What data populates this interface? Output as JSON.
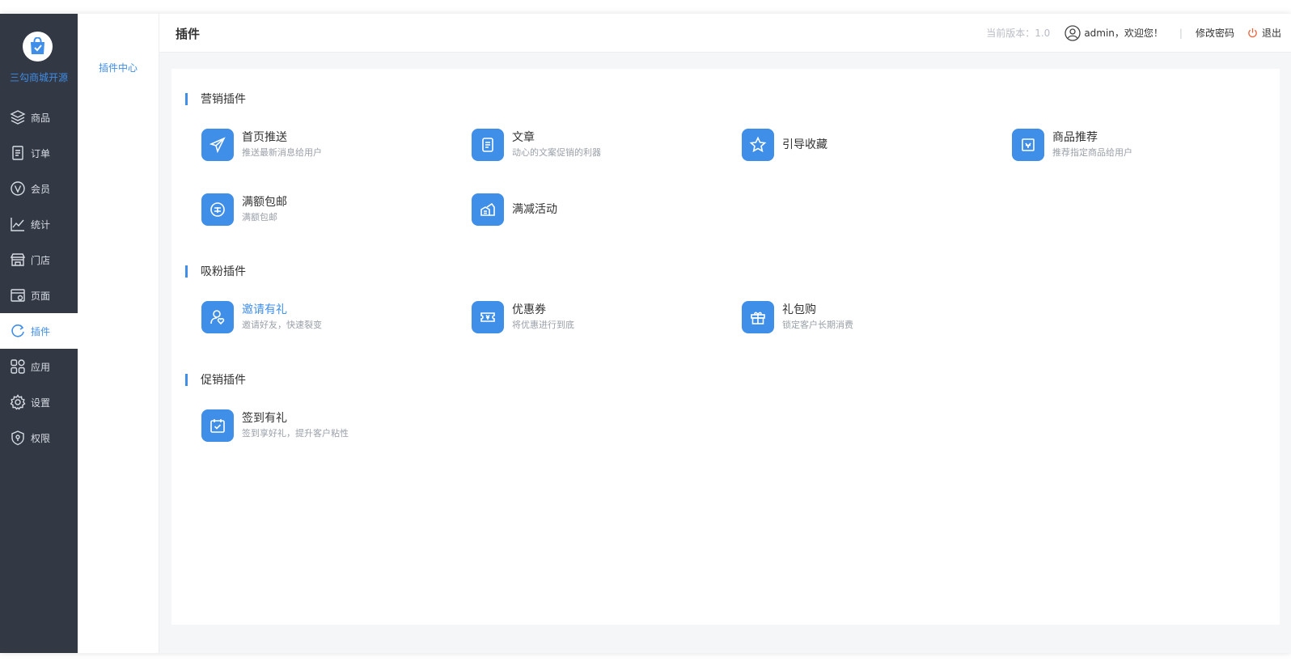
{
  "brand": {
    "name": "三勾商城开源"
  },
  "nav": [
    {
      "label": "商品",
      "icon": "layers-icon"
    },
    {
      "label": "订单",
      "icon": "order-icon"
    },
    {
      "label": "会员",
      "icon": "vip-icon"
    },
    {
      "label": "统计",
      "icon": "chart-icon"
    },
    {
      "label": "门店",
      "icon": "store-icon"
    },
    {
      "label": "页面",
      "icon": "page-icon"
    },
    {
      "label": "插件",
      "icon": "plugin-icon",
      "active": true
    },
    {
      "label": "应用",
      "icon": "apps-icon"
    },
    {
      "label": "设置",
      "icon": "gear-icon"
    },
    {
      "label": "权限",
      "icon": "shield-icon"
    }
  ],
  "subnav": {
    "item": "插件中心"
  },
  "header": {
    "title": "插件",
    "version": "当前版本：1.0",
    "user": "admin，欢迎您！",
    "separator": "|",
    "change_password": "修改密码",
    "logout": "退出"
  },
  "sections": [
    {
      "title": "营销插件",
      "items": [
        {
          "title": "首页推送",
          "desc": "推送最新消息给用户",
          "icon": "send-icon"
        },
        {
          "title": "文章",
          "desc": "动心的文案促销的利器",
          "icon": "article-icon"
        },
        {
          "title": "引导收藏",
          "desc": "",
          "icon": "star-icon"
        },
        {
          "title": "商品推荐",
          "desc": "推荐指定商品给用户",
          "icon": "recommend-icon"
        },
        {
          "title": "满额包邮",
          "desc": "满额包邮",
          "icon": "post-icon"
        },
        {
          "title": "满减活动",
          "desc": "",
          "icon": "discount-icon"
        }
      ]
    },
    {
      "title": "吸粉插件",
      "items": [
        {
          "title": "邀请有礼",
          "desc": "邀请好友，快速裂变",
          "icon": "invite-icon",
          "highlight": true
        },
        {
          "title": "优惠券",
          "desc": "将优惠进行到底",
          "icon": "coupon-icon"
        },
        {
          "title": "礼包购",
          "desc": "锁定客户长期消费",
          "icon": "gift-icon"
        }
      ]
    },
    {
      "title": "促销插件",
      "items": [
        {
          "title": "签到有礼",
          "desc": "签到享好礼，提升客户粘性",
          "icon": "checkin-icon"
        }
      ]
    }
  ],
  "colors": {
    "accent": "#3f8ee8",
    "sidebar": "#323844"
  }
}
